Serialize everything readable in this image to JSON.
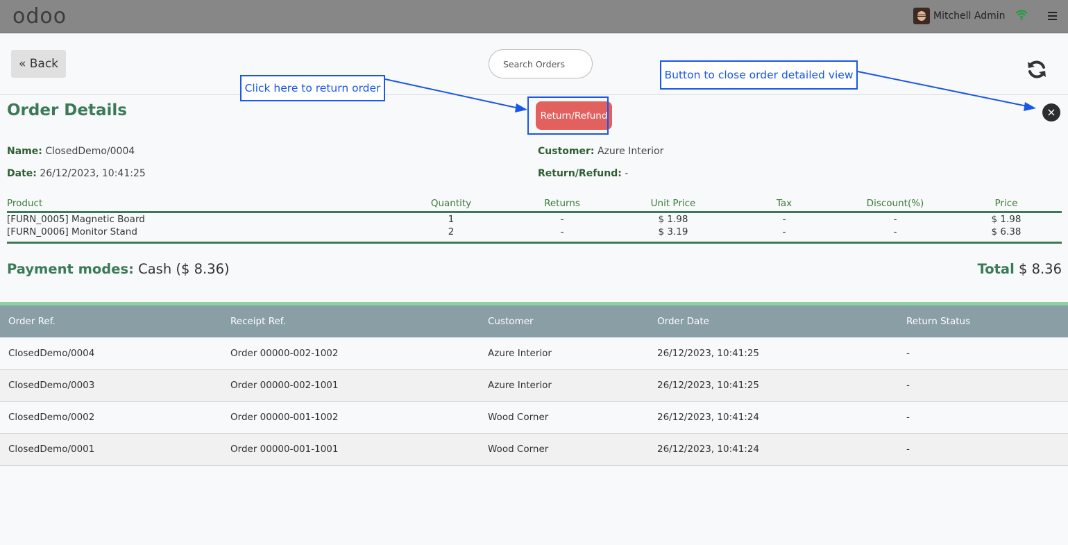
{
  "topbar": {
    "logo": "odoo",
    "user_name": "Mitchell Admin"
  },
  "controls": {
    "back_label": "« Back",
    "search_placeholder": "Search Orders"
  },
  "order_details": {
    "title": "Order Details",
    "return_button": "Return/Refund",
    "close_icon": "×",
    "name_label": "Name:",
    "name_value": "ClosedDemo/0004",
    "date_label": "Date:",
    "date_value": "26/12/2023, 10:41:25",
    "customer_label": "Customer:",
    "customer_value": "Azure Interior",
    "return_label": "Return/Refund:",
    "return_value": "-",
    "columns": [
      "Product",
      "Quantity",
      "Returns",
      "Unit Price",
      "Tax",
      "Discount(%)",
      "Price"
    ],
    "lines": [
      {
        "product": "[FURN_0005] Magnetic Board",
        "quantity": "1",
        "returns": "-",
        "unit_price": "$ 1.98",
        "tax": "-",
        "discount": "-",
        "price": "$ 1.98"
      },
      {
        "product": "[FURN_0006] Monitor Stand",
        "quantity": "2",
        "returns": "-",
        "unit_price": "$ 3.19",
        "tax": "-",
        "discount": "-",
        "price": "$ 6.38"
      }
    ],
    "payment_label": "Payment modes:",
    "payment_value": "Cash ($ 8.36)",
    "total_label": "Total",
    "total_value": "$ 8.36"
  },
  "orders_list": {
    "columns": [
      "Order Ref.",
      "Receipt Ref.",
      "Customer",
      "Order Date",
      "Return Status"
    ],
    "rows": [
      {
        "order_ref": "ClosedDemo/0004",
        "receipt_ref": "Order 00000-002-1002",
        "customer": "Azure Interior",
        "order_date": "26/12/2023, 10:41:25",
        "return_status": "-"
      },
      {
        "order_ref": "ClosedDemo/0003",
        "receipt_ref": "Order 00000-002-1001",
        "customer": "Azure Interior",
        "order_date": "26/12/2023, 10:41:25",
        "return_status": "-"
      },
      {
        "order_ref": "ClosedDemo/0002",
        "receipt_ref": "Order 00000-001-1002",
        "customer": "Wood Corner",
        "order_date": "26/12/2023, 10:41:24",
        "return_status": "-"
      },
      {
        "order_ref": "ClosedDemo/0001",
        "receipt_ref": "Order 00000-001-1001",
        "customer": "Wood Corner",
        "order_date": "26/12/2023, 10:41:24",
        "return_status": "-"
      }
    ]
  },
  "annotations": {
    "return_note": "Click here to return order",
    "close_note": "Button to close order detailed view"
  },
  "colors": {
    "accent_green": "#3b7a57",
    "return_red": "#e2605d",
    "annotation_blue": "#1a56e8",
    "list_header": "#8a9ea6"
  }
}
